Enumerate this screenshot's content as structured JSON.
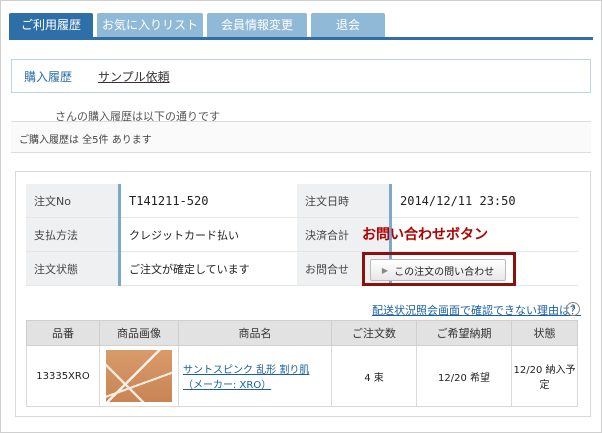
{
  "tabs": [
    {
      "label": "ご利用履歴"
    },
    {
      "label": "お気に入りリスト"
    },
    {
      "label": "会員情報変更"
    },
    {
      "label": "退会"
    }
  ],
  "subnav": {
    "history": "購入履歴",
    "sample": "サンプル依頼"
  },
  "greeting": "さんの購入履歴は以下の通りです",
  "summary": "ご購入履歴は 全5件 あります",
  "order": {
    "no_label": "注文No",
    "no_value": "T141211-520",
    "date_label": "注文日時",
    "date_value": "2014/12/11 23:50",
    "pay_label": "支払方法",
    "pay_value": "クレジットカード払い",
    "total_label": "決済合計",
    "status_label": "注文状態",
    "status_value": "ご注文が確定しています",
    "inquiry_label": "お問合せ"
  },
  "annotation": "お問い合わせボタン",
  "inquiry_button": "この注文の問い合わせ",
  "delivery_link": "配送状況照会画面で確認できない理由は？",
  "help_icon": "?",
  "product_table": {
    "headers": [
      "品番",
      "商品画像",
      "商品名",
      "ご注文数",
      "ご希望納期",
      "状態"
    ],
    "rows": [
      {
        "code": "13335XRO",
        "name": "サントスピンク 乱形 割り肌（メーカー: XRO）",
        "qty": "4 束",
        "desired": "12/20 希望",
        "status": "12/20 納入予定"
      }
    ]
  }
}
